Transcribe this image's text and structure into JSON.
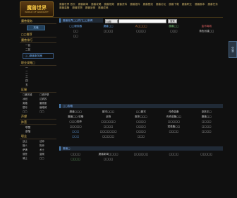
{
  "logo": {
    "title": "魔兽世界",
    "subtitle": "WORLD OF WARCRAFT"
  },
  "topnav": [
    "魔兽世界 首页",
    "魔兽新闻",
    "魔兽攻略",
    "魔兽视频",
    "魔兽资料",
    "魔兽插件",
    "魔兽壁纸",
    "魔兽论坛",
    "魔兽下载",
    "魔兽职业",
    "魔兽副本",
    "魔兽任务",
    "魔兽装备",
    "魔兽宠物",
    "魔兽坐骑",
    "魔兽成就"
  ],
  "sidebar": {
    "sections": [
      {
        "title": "魔兽服务",
        "items": [],
        "button": "充值"
      },
      {
        "title": "□□推荐",
        "items": [],
        "highlight": null
      },
      {
        "title": "魔兽排行",
        "items": [
          "一区",
          "二区"
        ]
      },
      {
        "title": "",
        "items": [],
        "highlight": "□□魔兽服务器"
      },
      {
        "title": "职业攻略□",
        "items": [
          "一",
          "二",
          "三",
          "四",
          "五"
        ]
      },
      {
        "title": "区服",
        "grid": [
          "□暴风城",
          "□铁炉堡",
          "冰冠",
          "达纳苏",
          "奥格",
          "雷霆崖",
          "银月",
          "幽暗城",
          "□□",
          "□□"
        ]
      },
      {
        "title": "声望",
        "items": []
      },
      {
        "title": "阵营",
        "items": [
          "联盟",
          "部落"
        ]
      },
      {
        "title": "职业",
        "grid": [
          "战士",
          "法师",
          "猎人",
          "牧师",
          "萨满",
          "术士",
          "德鲁",
          "盗贼",
          "骑士",
          "□□"
        ]
      }
    ]
  },
  "search": {
    "select": "标题",
    "button": "搜索"
  },
  "main": {
    "bar1": "魔兽世界□□热门□□新闻",
    "grid1": [
      {
        "t": "□□服务器",
        "c": "blue"
      },
      {
        "t": "魔兽□□",
        "c": "blue"
      },
      {
        "t": "人□□□□",
        "c": "orange"
      },
      {
        "t": "魔兽□□",
        "c": "green"
      },
      {
        "t": "金币商城",
        "c": "red"
      },
      {
        "t": "□□",
        "c": ""
      },
      {
        "t": "□□□□",
        "c": ""
      },
      {
        "t": "□□□□",
        "c": ""
      },
      {
        "t": "□□□",
        "c": ""
      },
      {
        "t": "角色创建□□",
        "c": ""
      },
      {
        "t": "□□",
        "c": ""
      }
    ],
    "bar2": "□□攻略",
    "grid2": [
      {
        "t": "魔兽□□□",
        "c": ""
      },
      {
        "t": "副本□□□",
        "c": ""
      },
      {
        "t": "□□副本",
        "c": ""
      },
      {
        "t": "传奇装备",
        "c": ""
      },
      {
        "t": "巫妖王□",
        "c": ""
      },
      {
        "t": "魔兽□□·攻略",
        "c": ""
      },
      {
        "t": "战场",
        "c": ""
      },
      {
        "t": "副本□□□",
        "c": ""
      },
      {
        "t": "传奇装备□□",
        "c": ""
      },
      {
        "t": "魔兽□□",
        "c": ""
      },
      {
        "t": "□□□法师",
        "c": ""
      },
      {
        "t": "□□□□□□",
        "c": ""
      },
      {
        "t": "□□□□",
        "c": ""
      },
      {
        "t": "□□□□□",
        "c": ""
      },
      {
        "t": "□□□□",
        "c": ""
      },
      {
        "t": "□□□□□",
        "c": ""
      },
      {
        "t": "□□□□",
        "c": ""
      },
      {
        "t": "□□□□",
        "c": ""
      },
      {
        "t": "宏装备□□",
        "c": ""
      },
      {
        "t": "□□□□",
        "c": ""
      },
      {
        "t": "□□□",
        "c": "blue"
      },
      {
        "t": "□□□□□□□",
        "c": ""
      },
      {
        "t": "□□□□",
        "c": ""
      },
      {
        "t": "□□□□",
        "c": ""
      },
      {
        "t": "□□□□",
        "c": ""
      },
      {
        "t": "□□□",
        "c": "blue"
      },
      {
        "t": "□□□□□",
        "c": ""
      },
      {
        "t": "□□□",
        "c": ""
      },
      {
        "t": "",
        "c": ""
      },
      {
        "t": "",
        "c": ""
      }
    ],
    "bar3": "魔兽□",
    "grid3": [
      {
        "t": "□□□□",
        "c": ""
      },
      {
        "t": "魔兽新闻□□□□",
        "c": ""
      },
      {
        "t": "□□□□□□",
        "c": ""
      },
      {
        "t": "□□□□",
        "c": ""
      },
      {
        "t": "□□□□□",
        "c": ""
      },
      {
        "t": "□□□□",
        "c": "green"
      },
      {
        "t": "□□□□",
        "c": ""
      },
      {
        "t": "",
        "c": ""
      },
      {
        "t": "",
        "c": ""
      },
      {
        "t": "",
        "c": ""
      }
    ]
  },
  "side_tab": "分享"
}
